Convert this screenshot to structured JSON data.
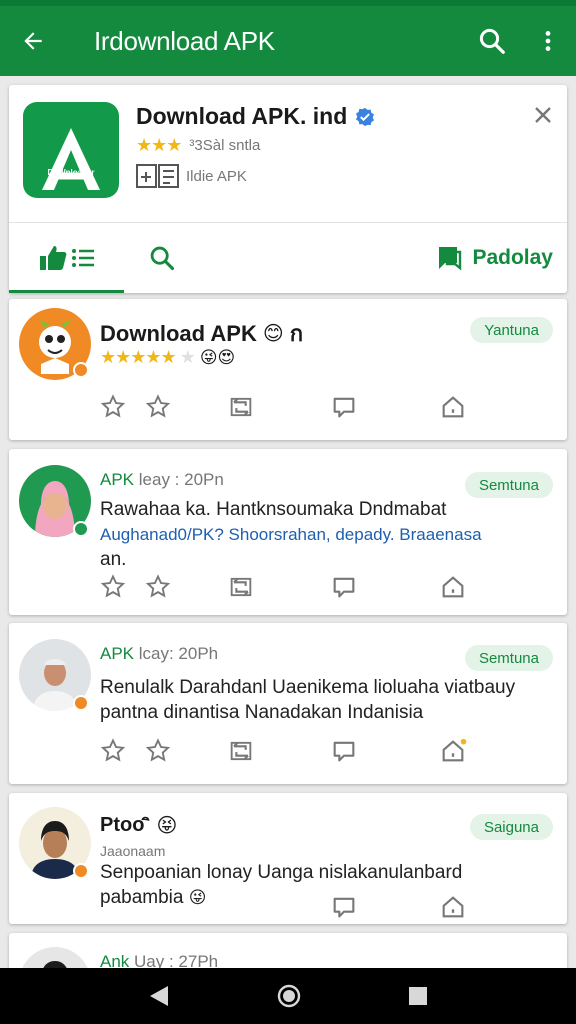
{
  "appbar": {
    "title": "Irdownload APK"
  },
  "header": {
    "app_name": "Download APK. ind",
    "rating_text": "³3Sàl sntla",
    "type_text": "Ildie APK",
    "icon_sub": "DoWnloader",
    "tabs": [
      {
        "name": "feed"
      },
      {
        "name": "search"
      },
      {
        "label": "Padolay"
      }
    ]
  },
  "posts": [
    {
      "title": "Download APK",
      "title_emoji": "😊",
      "title_extra": "ก",
      "stars": "★★★★★",
      "star_empty": "★",
      "emojis": "😜😍",
      "pill": "Yantuna"
    },
    {
      "meta_apk": "APK",
      "meta_rest": " leay : 20Pn",
      "text": "Rawahaa ka. Hantknsoumaka Dndmabat",
      "link": "Aughanad0/PK? Shoorsrahan, depady. Braaenasa",
      "text2": "an.",
      "pill": "Semtuna"
    },
    {
      "meta_apk": "APK",
      "meta_rest": " lcay: 20Ph",
      "text": "Renulalk Darahdanl Uaenikema lioluaha viatbauy pantna dinantisa Nanadakan Indanisia",
      "pill": "Semtuna"
    },
    {
      "title": "Ptoo",
      "title_extra": "ิ",
      "title_emoji": "😝",
      "subname": "Jaaonaam",
      "text": "Senpoanian lonay Uanga nislakanulanbard pabambia",
      "text_emoji": "😜",
      "pill": "Saiguna"
    },
    {
      "meta_apk": "Ank",
      "meta_rest": " Uay : 27Ph"
    }
  ],
  "colors": {
    "primary": "#138a3e",
    "primary_dark": "#0b7a34",
    "pill_bg": "#e4f3e8",
    "star": "#f2b617",
    "link": "#1e5fb0"
  }
}
